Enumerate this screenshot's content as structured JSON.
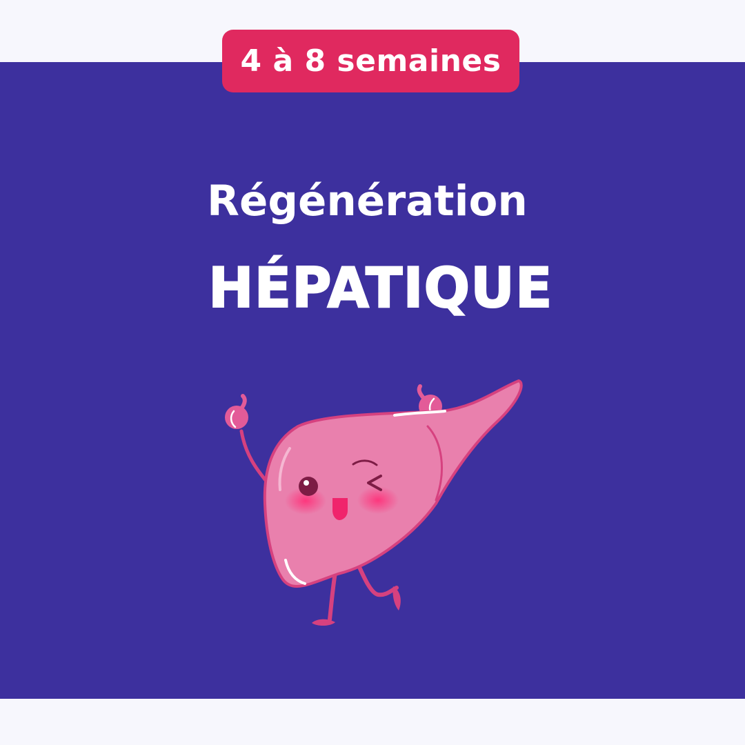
{
  "badge": {
    "text": "4 à 8 semaines"
  },
  "heading": {
    "line1": "Régénération",
    "line2": "HÉPATIQUE"
  },
  "illustration": {
    "subject": "liver-mascot-icon",
    "colors": {
      "body": "#e980ad",
      "outline": "#d6417f",
      "cheeks": "#f2337a",
      "eye": "#7d1c45",
      "mouth": "#f0246c"
    }
  },
  "colors": {
    "background": "#f7f7fd",
    "panel": "#3d309e",
    "badge": "#e0295f",
    "text": "#ffffff"
  }
}
